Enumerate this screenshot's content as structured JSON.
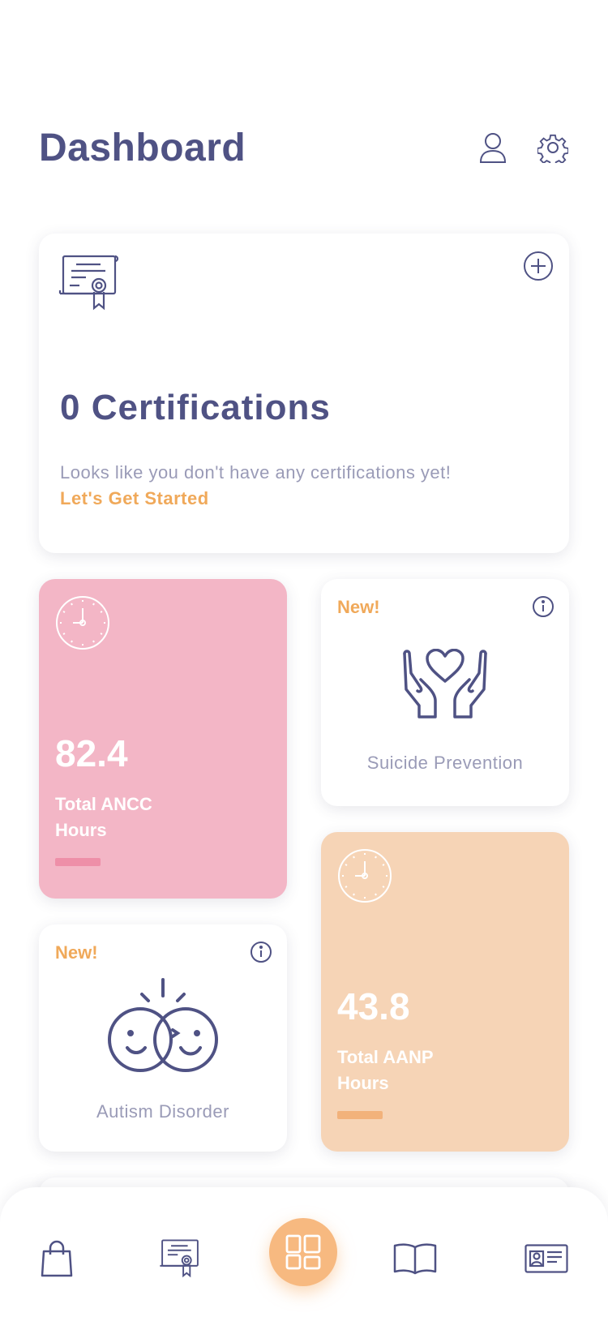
{
  "header": {
    "title": "Dashboard",
    "profile_icon": "user-icon",
    "settings_icon": "gear-icon"
  },
  "certifications": {
    "count_label": "0 Certifications",
    "message": "Looks like you don't have any certifications yet!",
    "cta": "Let's Get Started",
    "icon": "certificate-icon",
    "add_icon": "plus-circle-icon"
  },
  "ancc": {
    "value": "82.4",
    "label": "Total ANCC Hours",
    "progress": 0.1,
    "color": "#f3b6c6",
    "icon": "clock-icon"
  },
  "aanp": {
    "value": "43.8",
    "label": "Total AANP Hours",
    "progress": 0.1,
    "color": "#f6d4b6",
    "icon": "clock-icon"
  },
  "suicide": {
    "badge": "New!",
    "label": "Suicide Prevention",
    "icon": "hands-heart-icon",
    "info_icon": "info-icon"
  },
  "autism": {
    "badge": "New!",
    "label": "Autism Disorder",
    "icon": "smiling-faces-icon",
    "info_icon": "info-icon"
  },
  "nav": {
    "items": [
      {
        "icon": "shopping-bag-icon"
      },
      {
        "icon": "certificate-icon"
      },
      {
        "icon": "dashboard-grid-icon",
        "active": true
      },
      {
        "icon": "open-book-icon"
      },
      {
        "icon": "id-card-icon"
      }
    ]
  },
  "colors": {
    "primary": "#4f5284",
    "accent": "#f0a95a",
    "muted": "#9a9bb7",
    "nav_active": "#f7b980"
  }
}
